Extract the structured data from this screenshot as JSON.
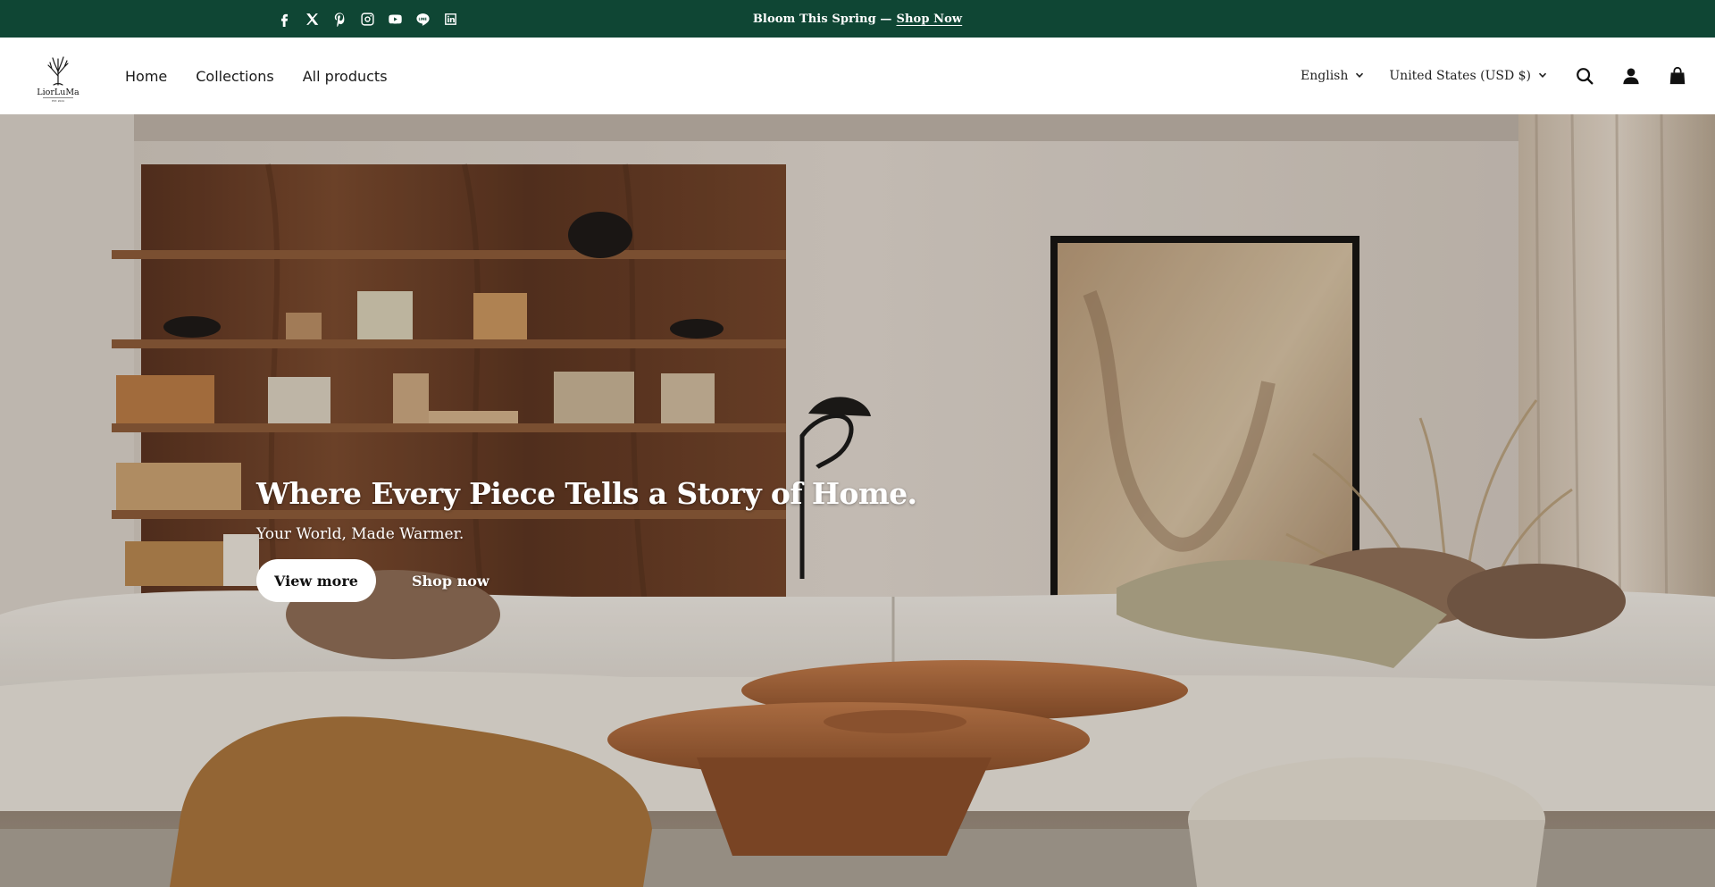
{
  "announcement": {
    "text": "Bloom This Spring —",
    "link": "Shop Now",
    "background": "#0f4634"
  },
  "socials": [
    {
      "name": "facebook-icon"
    },
    {
      "name": "x-icon"
    },
    {
      "name": "pinterest-icon"
    },
    {
      "name": "instagram-icon"
    },
    {
      "name": "youtube-icon"
    },
    {
      "name": "line-icon"
    },
    {
      "name": "linkedin-icon"
    }
  ],
  "header": {
    "logo_text": "LiorLuMa",
    "logo_tagline": "EST. 2024",
    "nav": [
      "Home",
      "Collections",
      "All products"
    ],
    "language": "English",
    "currency": "United States (USD $)",
    "icons": [
      "search-icon",
      "account-icon",
      "cart-icon"
    ]
  },
  "hero": {
    "title": "Where Every Piece Tells a Story of Home.",
    "subtitle": "Your World, Made Warmer.",
    "primary_button": "View more",
    "secondary_button": "Shop now"
  }
}
